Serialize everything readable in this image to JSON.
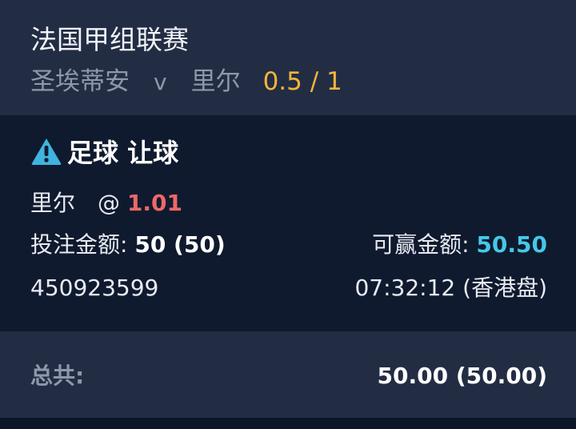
{
  "colors": {
    "header_bg": "#222d44",
    "card_bg": "#0f1a2e",
    "handicap": "#f3b53a",
    "odds": "#ee6868",
    "win_amount": "#45c8e8",
    "warning": "#3fb4e0"
  },
  "header": {
    "league": "法国甲组联赛",
    "home_team": "圣埃蒂安",
    "vs": "v",
    "away_team": "里尔",
    "handicap": "0.5 / 1"
  },
  "bet": {
    "icon": "warning-icon",
    "type": "足球 让球",
    "pick": "里尔",
    "at": "@",
    "odds": "1.01",
    "stake_label": "投注金额:",
    "stake_value": "50 (50)",
    "win_label": "可赢金额:",
    "win_value": "50.50",
    "ticket_id": "450923599",
    "time": "07:32:12 (香港盘)"
  },
  "total": {
    "label": "总共:",
    "value": "50.00 (50.00)"
  }
}
